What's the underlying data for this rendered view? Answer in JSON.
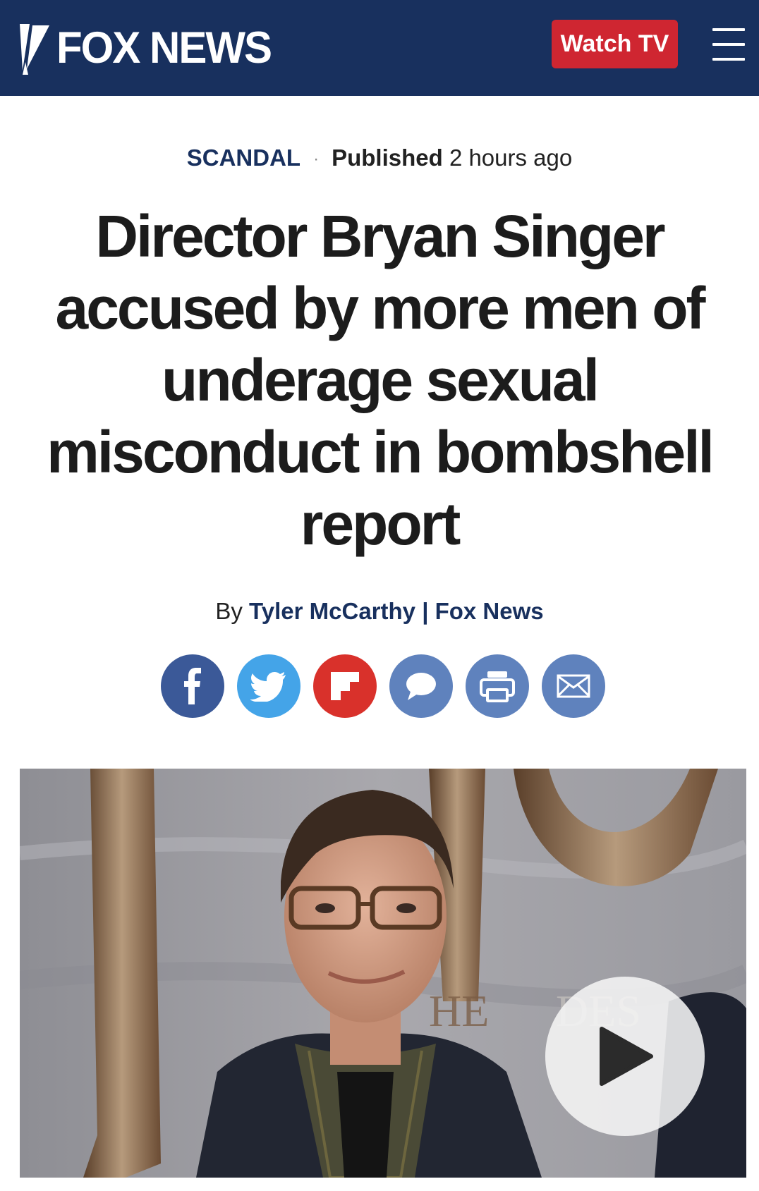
{
  "header": {
    "logo_text": "FOX NEWS",
    "watch_label": "Watch TV",
    "brand_color": "#18305e",
    "watch_color": "#cf2631"
  },
  "article": {
    "category": "SCANDAL",
    "separator": "·",
    "published_label": "Published",
    "published_time": "2 hours ago",
    "headline": "Director Bryan Singer accused by more men of underage sexual misconduct in bombshell report",
    "byline_prefix": "By",
    "author": "Tyler McCarthy",
    "byline_separator": "|",
    "outlet": "Fox News"
  },
  "share": [
    {
      "name": "facebook-icon",
      "color": "#3b5998"
    },
    {
      "name": "twitter-icon",
      "color": "#44a4e8"
    },
    {
      "name": "flipboard-icon",
      "color": "#d9312b"
    },
    {
      "name": "comment-icon",
      "color": "#5f82bd"
    },
    {
      "name": "print-icon",
      "color": "#5f82bd"
    },
    {
      "name": "email-icon",
      "color": "#5f82bd"
    }
  ],
  "media": {
    "play_icon": "play-icon"
  }
}
